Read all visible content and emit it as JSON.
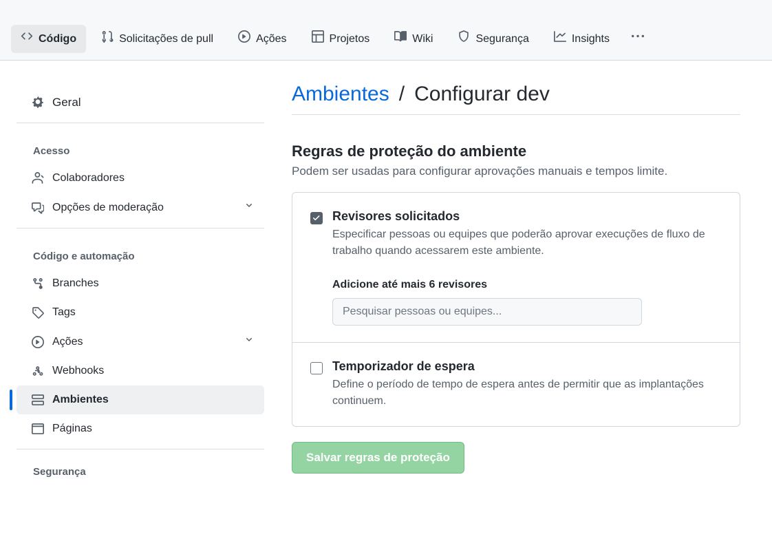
{
  "topnav": {
    "items": [
      {
        "label": "Código",
        "icon": "code",
        "selected": true
      },
      {
        "label": "Solicitações de pull",
        "icon": "git-pull-request"
      },
      {
        "label": "Ações",
        "icon": "play"
      },
      {
        "label": "Projetos",
        "icon": "table"
      },
      {
        "label": "Wiki",
        "icon": "book"
      },
      {
        "label": "Segurança",
        "icon": "shield"
      },
      {
        "label": "Insights",
        "icon": "graph"
      }
    ]
  },
  "sidebar": {
    "general": "Geral",
    "group_access": "Acesso",
    "access": [
      {
        "label": "Colaboradores",
        "icon": "people"
      },
      {
        "label": "Opções de moderação",
        "icon": "comment-discussion",
        "expandable": true
      }
    ],
    "group_code": "Código e automação",
    "code": [
      {
        "label": "Branches",
        "icon": "git-branch"
      },
      {
        "label": "Tags",
        "icon": "tag"
      },
      {
        "label": "Ações",
        "icon": "play",
        "expandable": true
      },
      {
        "label": "Webhooks",
        "icon": "webhook"
      },
      {
        "label": "Ambientes",
        "icon": "server",
        "active": true
      },
      {
        "label": "Páginas",
        "icon": "browser"
      }
    ],
    "group_security": "Segurança"
  },
  "breadcrumb": {
    "root": "Ambientes",
    "sep": "/",
    "current": "Configurar dev"
  },
  "protection": {
    "heading": "Regras de proteção do ambiente",
    "subheading": "Podem ser usadas para configurar aprovações manuais e tempos limite.",
    "reviewers": {
      "title": "Revisores solicitados",
      "desc": "Especificar pessoas ou equipes que poderão aprovar execuções de fluxo de trabalho quando acessarem este ambiente.",
      "checked": true,
      "add_label": "Adicione até mais 6 revisores",
      "search_placeholder": "Pesquisar pessoas ou equipes..."
    },
    "wait": {
      "title": "Temporizador de espera",
      "desc": "Define o período de tempo de espera antes de permitir que as implantações continuem.",
      "checked": false
    },
    "save_label": "Salvar regras de proteção"
  }
}
